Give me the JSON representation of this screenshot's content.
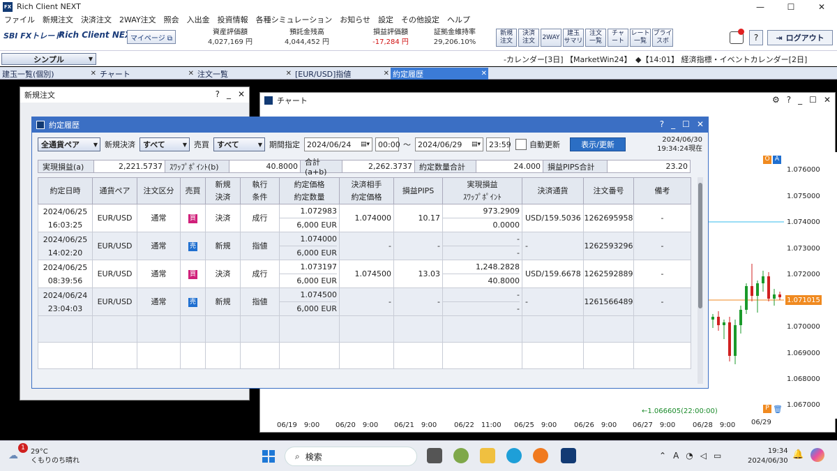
{
  "window": {
    "title": "Rich Client NEXT",
    "min": "—",
    "max": "☐",
    "close": "✕"
  },
  "menu": [
    "ファイル",
    "新規注文",
    "決済注文",
    "2WAY注文",
    "照会",
    "入出金",
    "投資情報",
    "各種シミュレーション",
    "お知らせ",
    "設定",
    "その他設定",
    "ヘルプ"
  ],
  "header": {
    "logo_broker": "SBI FXトレード",
    "logo_app": "Rich Client NEXT",
    "mypage": "マイページ ⧉",
    "stats": [
      {
        "label": "資産評価額",
        "value": "4,027,169 円"
      },
      {
        "label": "預託金残高",
        "value": "4,044,452 円"
      },
      {
        "label": "損益評価額",
        "value": "-17,284 円"
      },
      {
        "label": "証拠金維持率",
        "value": "29,206.10%"
      }
    ],
    "tool_buttons": [
      "新規\n注文",
      "決済\n注文",
      "2WAY",
      "建玉\nサマリ",
      "注文\n一覧",
      "チャ\nート",
      "レート\n一覧",
      "プライ\nスボ"
    ],
    "help": "?",
    "logout": "ログアウト"
  },
  "layout_select": "シンプル",
  "ticker": "-カレンダー[3日] 【MarketWin24】　◆【14:01】 経済指標・イベントカレンダー[2日]",
  "tabs": [
    "建玉一覧(個別)",
    "チャート",
    "注文一覧",
    "[EUR/USD]指値",
    "約定履歴"
  ],
  "order_window": {
    "title": "新規注文"
  },
  "chart_window": {
    "title": "チャート",
    "price_ticks": [
      "1.076000",
      "1.075000",
      "1.074000",
      "1.073000",
      "1.072000",
      "1.071000",
      "1.070000",
      "1.069000",
      "1.068000",
      "1.067000"
    ],
    "current_price": "1.071015",
    "low_label": "←1.066605(22:00:00)",
    "dates": [
      "06/19　9:00",
      "06/20　9:00",
      "06/21　9:00",
      "06/22　11:00",
      "06/25　9:00",
      "06/26　9:00",
      "06/27　9:00",
      "06/28　9:00",
      "06/29"
    ]
  },
  "fills_window": {
    "title": "約定履歴",
    "currency_pair_select": "全通貨ペア",
    "settle_label": "新規決済",
    "settle_select": "すべて",
    "side_label": "売買",
    "side_select": "すべて",
    "period_label": "期間指定",
    "date_from": "2024/06/24",
    "time_from": "00:00",
    "tilde": "～",
    "date_to": "2024/06/29",
    "time_to": "23:59",
    "auto_refresh": "自動更新",
    "refresh_button": "表示/更新",
    "asof_date": "2024/06/30",
    "asof_time": "19:34:24現在",
    "summary": {
      "realized_label": "実現損益(a)",
      "realized": "2,221.5737",
      "swap_label": "ｽﾜｯﾌﾟﾎﾟｲﾝﾄ(b)",
      "swap": "40.8000",
      "total_label": "合計(a+b)",
      "total": "2,262.3737",
      "qty_label": "約定数量合計",
      "qty": "24.000",
      "pips_label": "損益PIPS合計",
      "pips": "23.20"
    },
    "columns": [
      "約定日時",
      "通貨ペア",
      "注文区分",
      "売買",
      "新規\n決済",
      "執行\n条件",
      "約定価格\n約定数量",
      "決済相手\n約定価格",
      "損益PIPS",
      "実現損益\nｽﾜｯﾌﾟﾎﾟｲﾝﾄ",
      "決済通貨",
      "注文番号",
      "備考"
    ],
    "rows": [
      {
        "date": "2024/06/25",
        "time": "16:03:25",
        "pair": "EUR/USD",
        "type": "通常",
        "side": "買",
        "side_kind": "buy",
        "open_close": "決済",
        "cond": "成行",
        "price": "1.072983",
        "qty": "6,000 EUR",
        "counter": "1.074000",
        "pips": "10.17",
        "pl": "973.2909",
        "swap": "0.0000",
        "ccy": "USD/159.5036",
        "no": "1262695958",
        "memo": "-"
      },
      {
        "date": "2024/06/25",
        "time": "14:02:20",
        "pair": "EUR/USD",
        "type": "通常",
        "side": "売",
        "side_kind": "sell",
        "open_close": "新規",
        "cond": "指値",
        "price": "1.074000",
        "qty": "6,000 EUR",
        "counter": "-",
        "pips": "-",
        "pl": "-",
        "swap": "-",
        "ccy": "-",
        "no": "1262593296",
        "memo": "-"
      },
      {
        "date": "2024/06/25",
        "time": "08:39:56",
        "pair": "EUR/USD",
        "type": "通常",
        "side": "買",
        "side_kind": "buy",
        "open_close": "決済",
        "cond": "成行",
        "price": "1.073197",
        "qty": "6,000 EUR",
        "counter": "1.074500",
        "pips": "13.03",
        "pl": "1,248.2828",
        "swap": "40.8000",
        "ccy": "USD/159.6678",
        "no": "1262592889",
        "memo": "-"
      },
      {
        "date": "2024/06/24",
        "time": "23:04:03",
        "pair": "EUR/USD",
        "type": "通常",
        "side": "売",
        "side_kind": "sell",
        "open_close": "新規",
        "cond": "指値",
        "price": "1.074500",
        "qty": "6,000 EUR",
        "counter": "-",
        "pips": "-",
        "pl": "-",
        "swap": "-",
        "ccy": "-",
        "no": "1261566489",
        "memo": "-"
      }
    ]
  },
  "taskbar": {
    "temp": "29°C",
    "weather": "くもりのち晴れ",
    "badge": "1",
    "search": "検索",
    "time": "19:34",
    "date": "2024/06/30"
  }
}
